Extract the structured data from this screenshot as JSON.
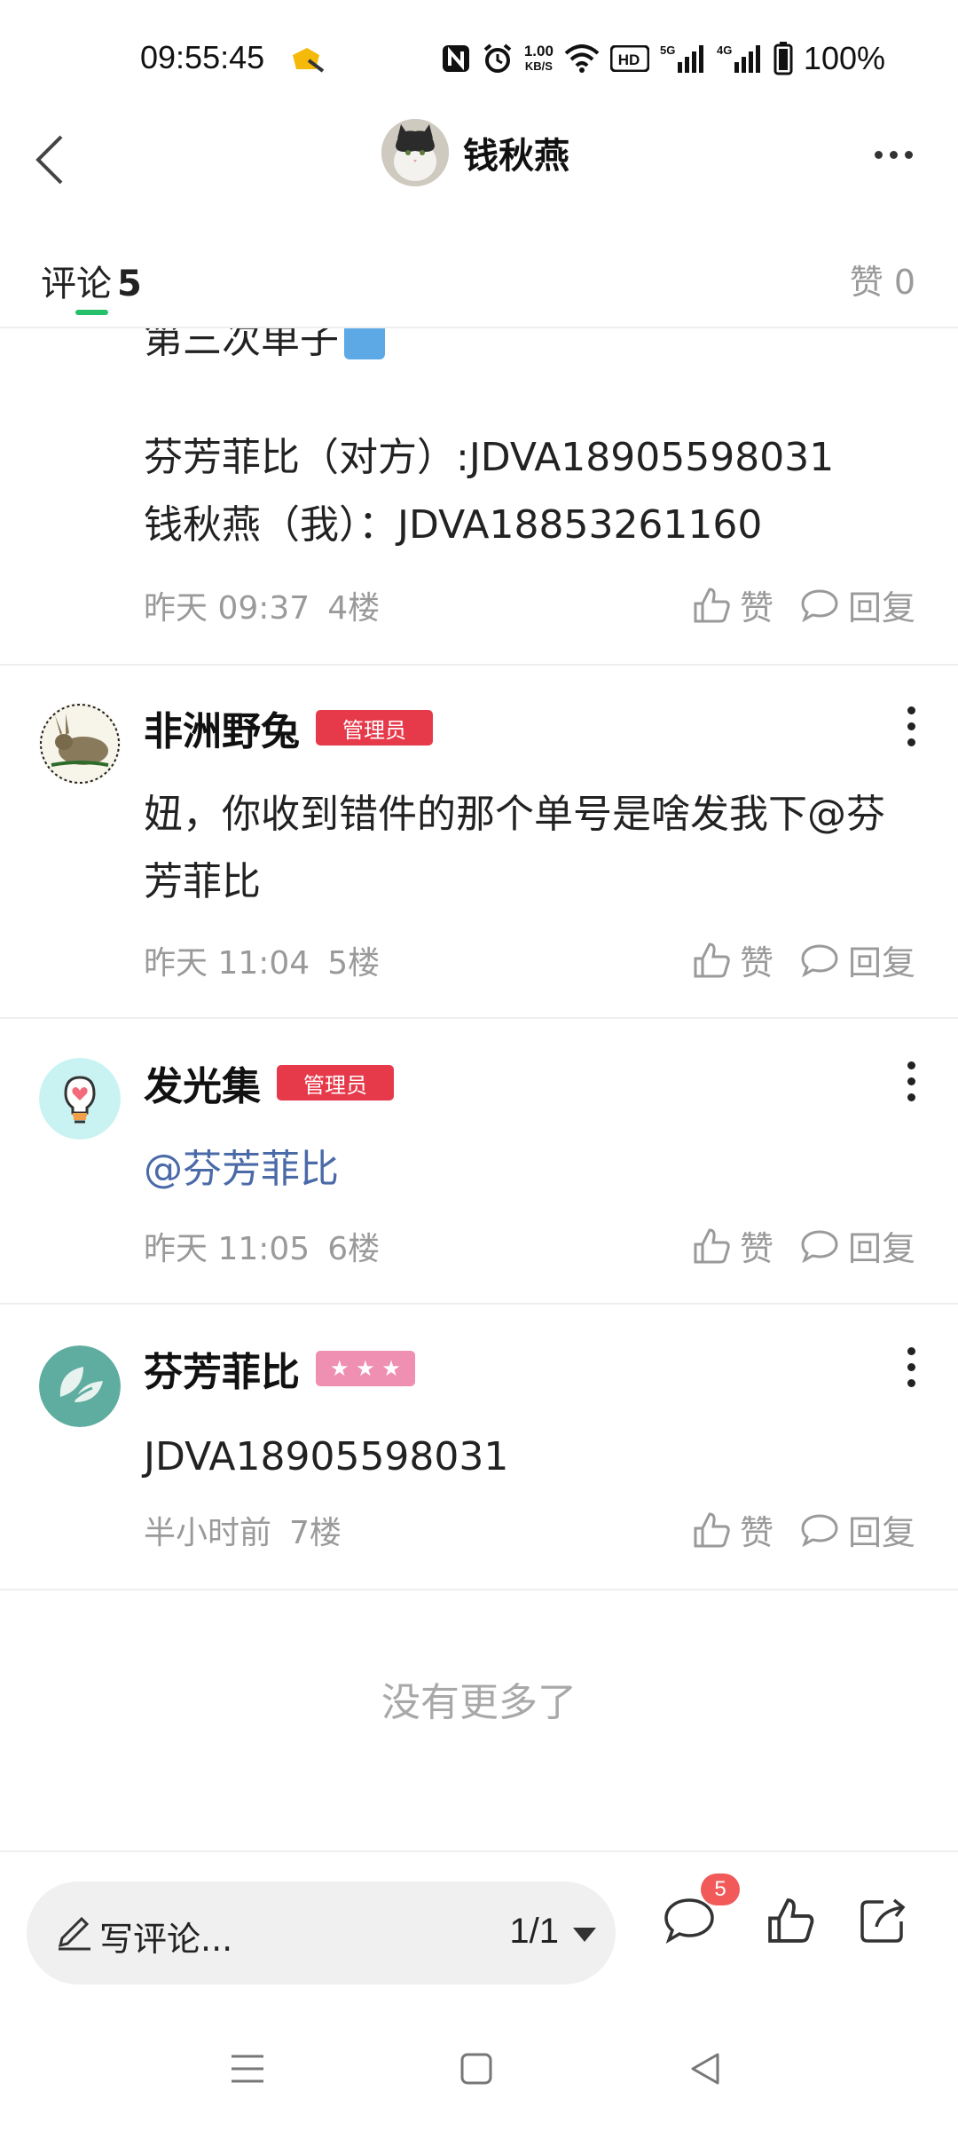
{
  "status_bar": {
    "time": "09:55:45",
    "net_speed_value": "1.00",
    "net_speed_unit": "KB/S",
    "hd_label": "HD",
    "sim1_label": "5G",
    "sim2_label": "4G",
    "battery": "100%",
    "icons": [
      "app-notification-icon",
      "nfc-icon",
      "alarm-icon",
      "wifi-icon",
      "hd-voice-icon",
      "signal-5g-icon",
      "signal-4g-icon",
      "battery-icon"
    ]
  },
  "header": {
    "title": "钱秋燕",
    "back_icon": "chevron-left-icon",
    "more_icon": "more-horizontal-icon"
  },
  "tabs": {
    "comments_label": "评论",
    "comments_count": "5",
    "likes_label": "赞 0",
    "accent_color": "#27c06a"
  },
  "comments_partial": {
    "cutoff_text": "第三次单子",
    "line1": "芬芳菲比（对方）:JDVA18905598031",
    "line2": "钱秋燕（我）：JDVA18853261160",
    "time": "昨天 09:37",
    "floor": "4楼",
    "like_label": "赞",
    "reply_label": "回复"
  },
  "comments": [
    {
      "name": "非洲野兔",
      "badge": "管理员",
      "body": "妞，你收到错件的那个单号是啥发我下@芬芳菲比",
      "time": "昨天 11:04",
      "floor": "5楼",
      "like_label": "赞",
      "reply_label": "回复"
    },
    {
      "name": "发光集",
      "badge": "管理员",
      "body": "@芬芳菲比",
      "time": "昨天 11:05",
      "floor": "6楼",
      "like_label": "赞",
      "reply_label": "回复"
    },
    {
      "name": "芬芳菲比",
      "badge": "★ ★ ★",
      "body": "JDVA18905598031",
      "time": "半小时前",
      "floor": "7楼",
      "like_label": "赞",
      "reply_label": "回复"
    }
  ],
  "no_more": "没有更多了",
  "bottom_bar": {
    "input_placeholder": "写评论...",
    "page_indicator": "1/1",
    "comment_count": "5",
    "icons": [
      "pencil-icon",
      "comment-icon",
      "thumbs-up-icon",
      "share-icon"
    ]
  },
  "system_nav": {
    "icons": [
      "menu-icon",
      "home-icon",
      "back-triangle-icon"
    ]
  },
  "colors": {
    "admin_badge": "#e6394a",
    "stars_badge": "#ef8fb1",
    "mention": "#4a6aa8",
    "count_badge": "#f25a5a"
  }
}
